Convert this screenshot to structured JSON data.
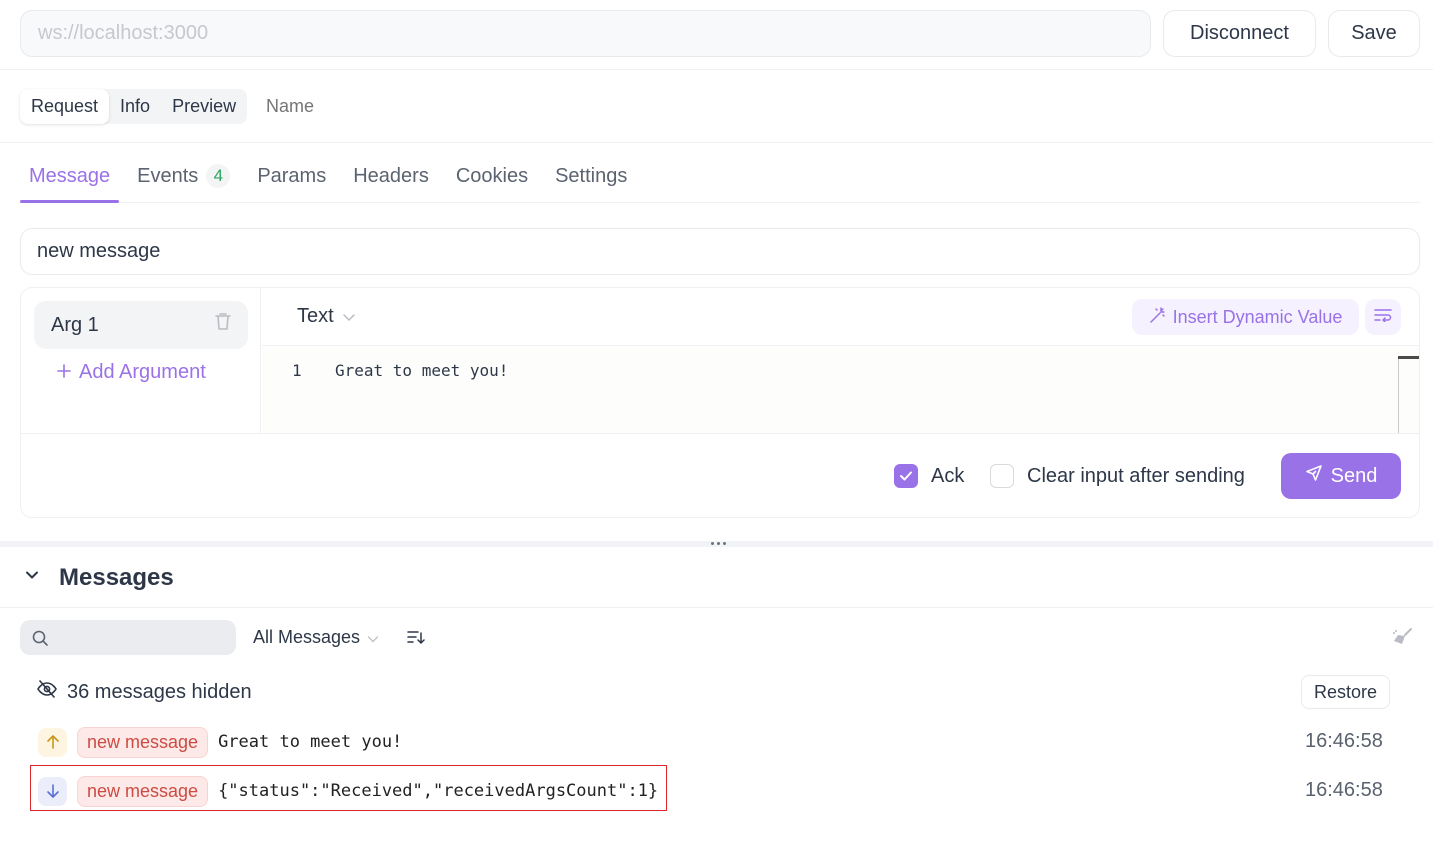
{
  "topbar": {
    "url_value": "ws://localhost:3000",
    "disconnect_label": "Disconnect",
    "save_label": "Save"
  },
  "segmented": {
    "items": [
      "Request",
      "Info",
      "Preview"
    ],
    "active": "Request",
    "name_placeholder": "Name"
  },
  "tabs": {
    "items": [
      {
        "label": "Message",
        "active": true
      },
      {
        "label": "Events",
        "badge": "4"
      },
      {
        "label": "Params"
      },
      {
        "label": "Headers"
      },
      {
        "label": "Cookies"
      },
      {
        "label": "Settings"
      }
    ]
  },
  "editor": {
    "event_name": "new message",
    "args": [
      {
        "label": "Arg 1"
      }
    ],
    "add_argument_label": "Add Argument",
    "type_select": "Text",
    "insert_dynamic_label": "Insert Dynamic Value",
    "lines": [
      {
        "no": "1",
        "text": "Great to meet you!"
      }
    ],
    "ack_label": "Ack",
    "ack_checked": true,
    "clear_label": "Clear input after sending",
    "clear_checked": false,
    "send_label": "Send"
  },
  "messages": {
    "title": "Messages",
    "search_placeholder": "",
    "filter_label": "All Messages",
    "hidden_text": "36 messages hidden",
    "restore_label": "Restore",
    "items": [
      {
        "direction": "outgoing",
        "event": "new message",
        "payload": "Great to meet you!",
        "time": "16:46:58"
      },
      {
        "direction": "incoming",
        "event": "new message",
        "payload": "{\"status\":\"Received\",\"receivedArgsCount\":1}",
        "time": "16:46:58"
      }
    ]
  },
  "colors": {
    "accent": "#9a72e8",
    "event_pill_text": "#cc4b44",
    "badge_green": "#2ea55e",
    "highlight_border": "#d9262c"
  }
}
